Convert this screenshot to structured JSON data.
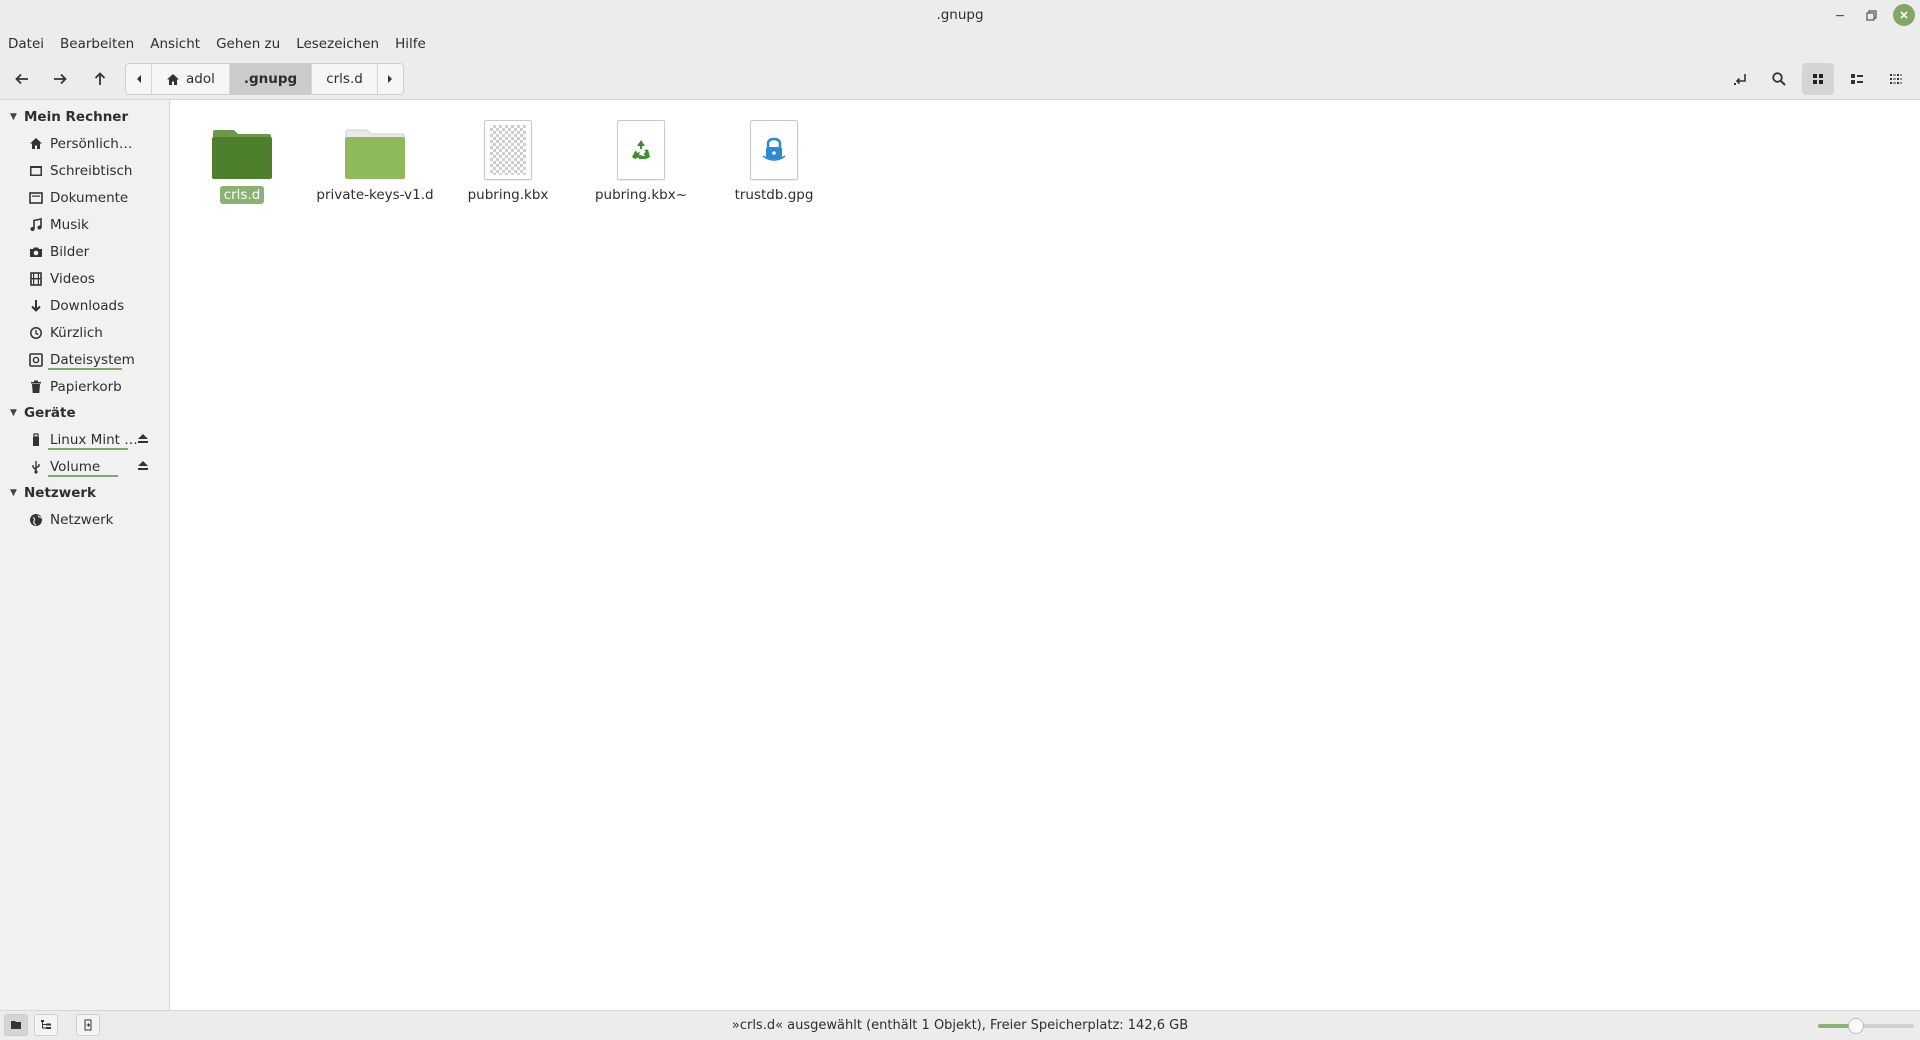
{
  "window": {
    "title": ".gnupg"
  },
  "menu": [
    "Datei",
    "Bearbeiten",
    "Ansicht",
    "Gehen zu",
    "Lesezeichen",
    "Hilfe"
  ],
  "pathbar": {
    "segments": [
      {
        "label": "adol",
        "icon": "home-icon"
      },
      {
        "label": ".gnupg",
        "active": true
      },
      {
        "label": "crls.d"
      }
    ]
  },
  "sidebar": {
    "sections": [
      {
        "label": "Mein Rechner",
        "items": [
          {
            "label": "Persönlich…",
            "icon": "home-icon"
          },
          {
            "label": "Schreibtisch",
            "icon": "desktop-icon"
          },
          {
            "label": "Dokumente",
            "icon": "documents-icon"
          },
          {
            "label": "Musik",
            "icon": "music-icon"
          },
          {
            "label": "Bilder",
            "icon": "camera-icon"
          },
          {
            "label": "Videos",
            "icon": "film-icon"
          },
          {
            "label": "Downloads",
            "icon": "download-icon"
          },
          {
            "label": "Kürzlich",
            "icon": "history-icon"
          },
          {
            "label": "Dateisystem",
            "icon": "drive-icon",
            "usage": 0.48
          },
          {
            "label": "Papierkorb",
            "icon": "trash-icon"
          }
        ]
      },
      {
        "label": "Geräte",
        "items": [
          {
            "label": "Linux Mint …",
            "icon": "usb-stick-icon",
            "eject": true,
            "usage": 0.65
          },
          {
            "label": "Volume",
            "icon": "usb-icon",
            "eject": true,
            "usage": 0.6
          }
        ]
      },
      {
        "label": "Netzwerk",
        "items": [
          {
            "label": "Netzwerk",
            "icon": "globe-icon"
          }
        ]
      }
    ]
  },
  "files": [
    {
      "name": "crls.d",
      "type": "folder-dark",
      "selected": true
    },
    {
      "name": "private-keys-v1.d",
      "type": "folder"
    },
    {
      "name": "pubring.kbx",
      "type": "binary"
    },
    {
      "name": "pubring.kbx~",
      "type": "backup"
    },
    {
      "name": "trustdb.gpg",
      "type": "gpg"
    }
  ],
  "status": {
    "text": "»crls.d« ausgewählt (enthält 1 Objekt), Freier Speicherplatz: 142,6 GB"
  },
  "zoom": {
    "level": 0.4
  },
  "colors": {
    "accent": "#8bb173",
    "folder_dark": "#4e7f2c",
    "folder": "#8fba5c"
  }
}
